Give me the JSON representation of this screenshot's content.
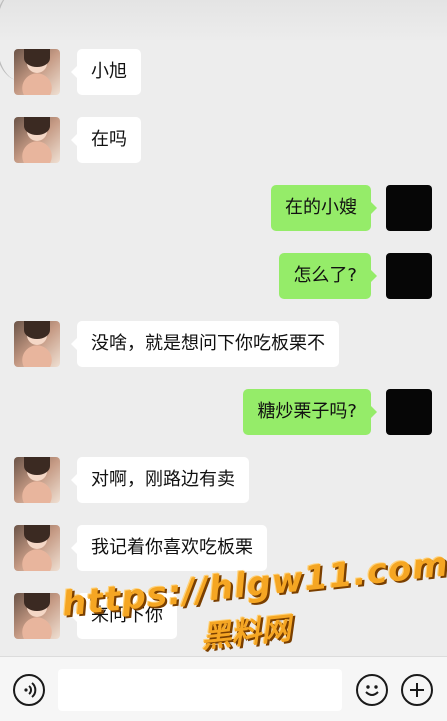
{
  "messages": [
    {
      "side": "in",
      "text": "小旭"
    },
    {
      "side": "in",
      "text": "在吗"
    },
    {
      "side": "out",
      "text": "在的小嫂"
    },
    {
      "side": "out",
      "text": "怎么了?"
    },
    {
      "side": "in",
      "text": "没啥，就是想问下你吃板栗不"
    },
    {
      "side": "out",
      "text": "糖炒栗子吗?"
    },
    {
      "side": "in",
      "text": "对啊，刚路边有卖"
    },
    {
      "side": "in",
      "text": "我记着你喜欢吃板栗"
    },
    {
      "side": "in",
      "text": "来问下你"
    }
  ],
  "watermark": {
    "url": "https://hlgw11.com",
    "name": "黑料网"
  },
  "icons": {
    "voice": "voice-icon",
    "emoji": "emoji-icon",
    "add": "plus-icon"
  },
  "colors": {
    "background": "#ededed",
    "incoming_bubble": "#ffffff",
    "outgoing_bubble": "#95ec69",
    "self_avatar": "#060606",
    "watermark": "#f5a623"
  }
}
